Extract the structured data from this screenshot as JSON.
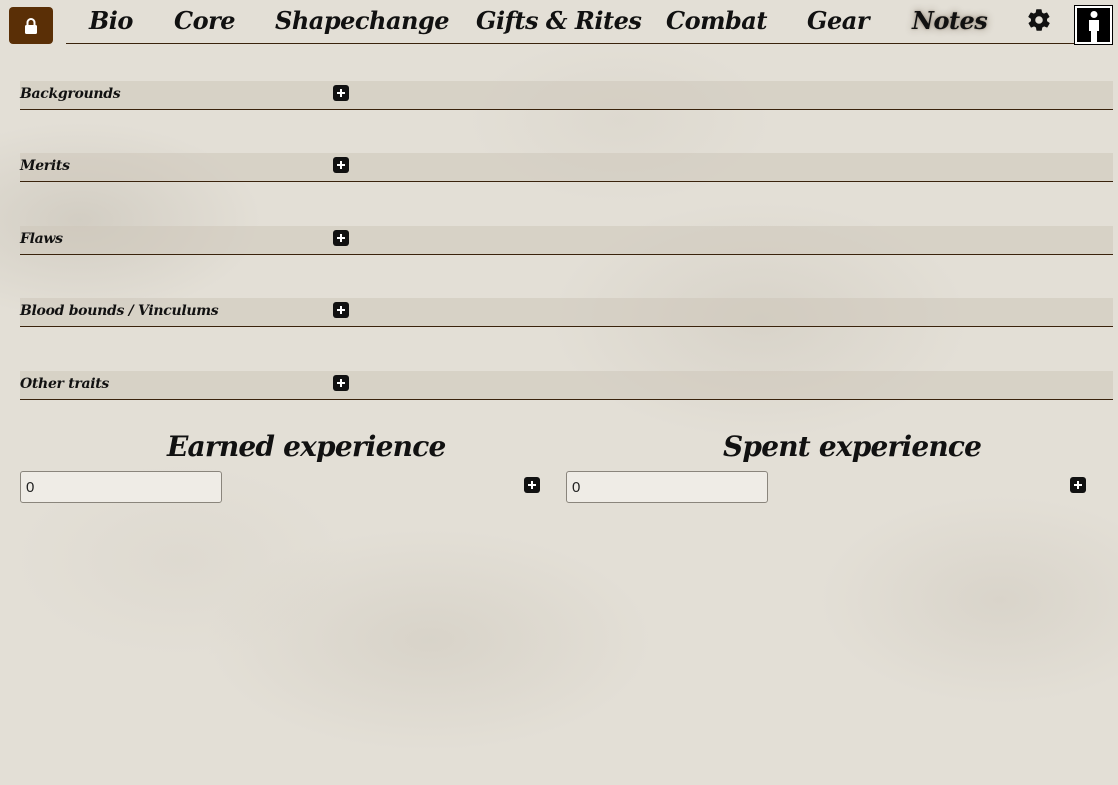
{
  "nav": {
    "lock_icon": "lock-icon",
    "tabs": [
      {
        "label": "Bio"
      },
      {
        "label": "Core"
      },
      {
        "label": "Shapechange"
      },
      {
        "label": "Gifts & Rites"
      },
      {
        "label": "Combat"
      },
      {
        "label": "Gear"
      },
      {
        "label": "Notes",
        "active": true
      }
    ],
    "settings_icon": "gear-icon",
    "avatar_icon": "person-silhouette-icon"
  },
  "sections": [
    {
      "title": "Backgrounds"
    },
    {
      "title": "Merits"
    },
    {
      "title": "Flaws"
    },
    {
      "title": "Blood bounds / Vinculums"
    },
    {
      "title": "Other traits"
    }
  ],
  "experience": {
    "earned": {
      "title": "Earned experience",
      "value": "0"
    },
    "spent": {
      "title": "Spent experience",
      "value": "0"
    }
  },
  "colors": {
    "accent": "#5a2f06",
    "divider": "#3a230c",
    "text": "#111111",
    "background": "#e3dfd6"
  }
}
